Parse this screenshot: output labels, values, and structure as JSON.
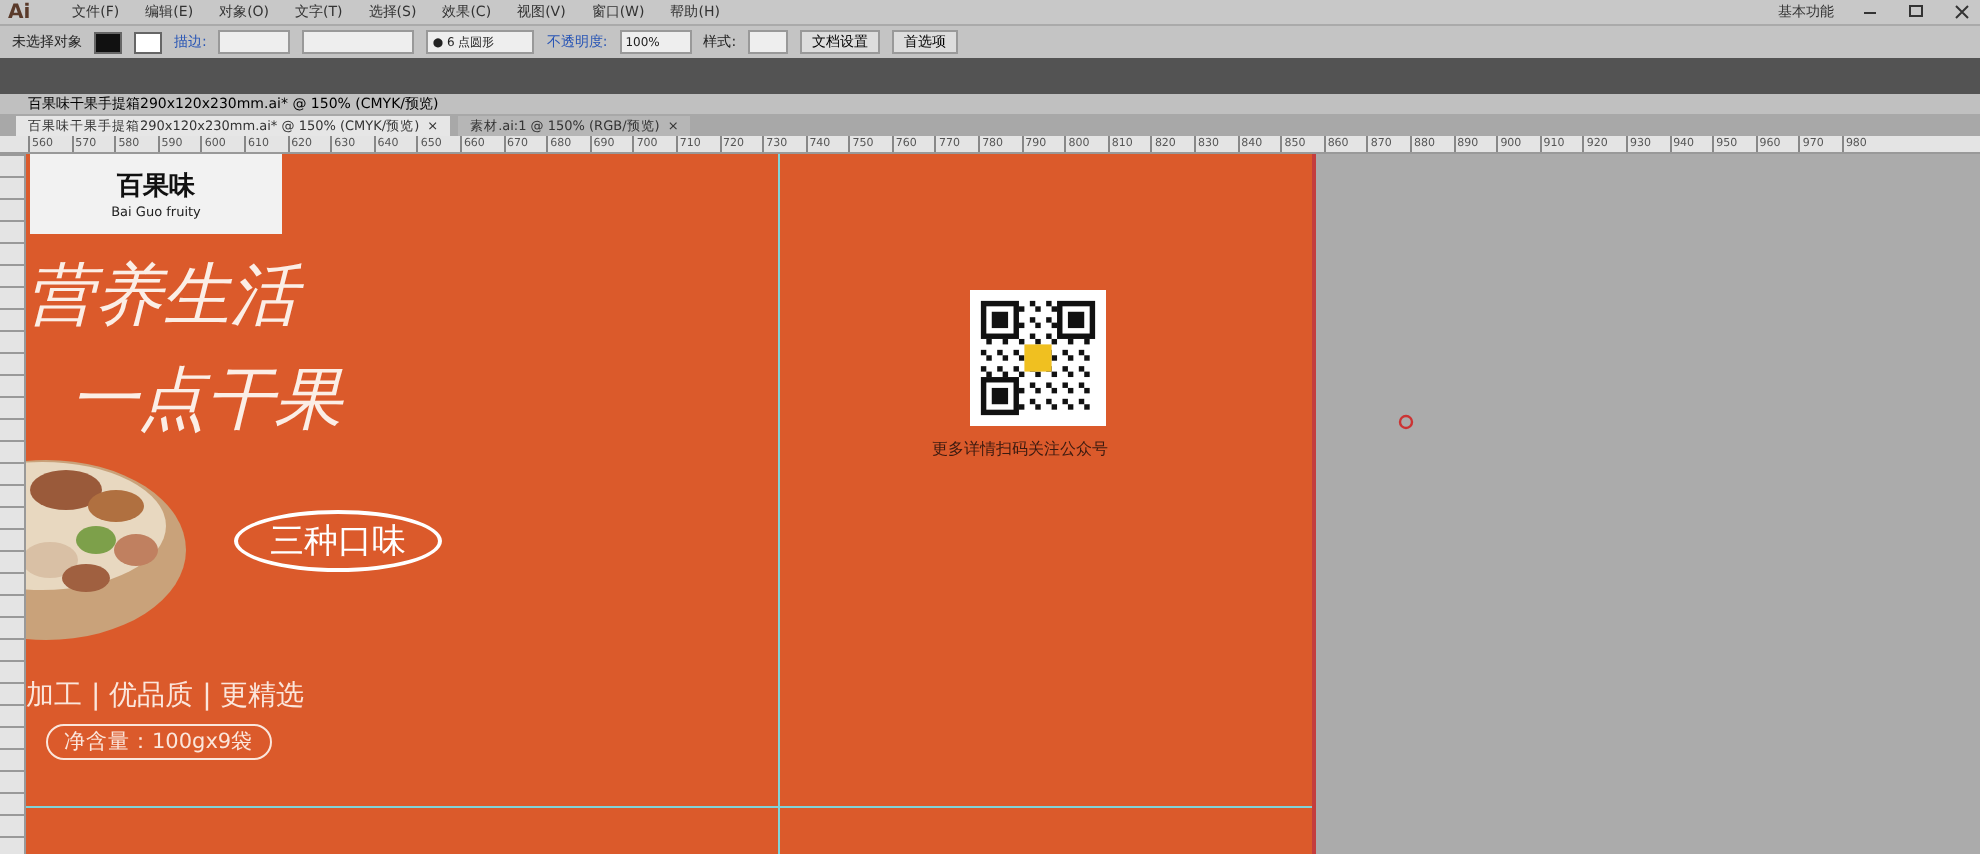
{
  "app": {
    "logo": "Ai",
    "menus": [
      "文件(F)",
      "编辑(E)",
      "对象(O)",
      "文字(T)",
      "选择(S)",
      "效果(C)",
      "视图(V)",
      "窗口(W)",
      "帮助(H)"
    ],
    "workspace": "基本功能"
  },
  "control_bar": {
    "selection": "未选择对象",
    "stroke_label": "描边:",
    "brush": "● 6 点圆形",
    "opacity_label": "不透明度:",
    "opacity": "100%",
    "style_label": "样式:",
    "buttons": [
      "文档设置",
      "首选项"
    ]
  },
  "document": {
    "title": "百果味干果手提箱290x120x230mm.ai* @ 150% (CMYK/预览)"
  },
  "tabs": [
    {
      "label": "百果味干果手提箱290x120x230mm.ai* @ 150% (CMYK/预览)",
      "close": "×",
      "selected": true
    },
    {
      "label": "素材.ai:1 @ 150% (RGB/预览)",
      "close": "×",
      "selected": false
    }
  ],
  "ruler": [
    "560",
    "570",
    "580",
    "590",
    "600",
    "610",
    "620",
    "630",
    "640",
    "650",
    "660",
    "670",
    "680",
    "690",
    "700",
    "710",
    "720",
    "730",
    "740",
    "750",
    "760",
    "770",
    "780",
    "790",
    "800",
    "810",
    "820",
    "830",
    "840",
    "850",
    "860",
    "870",
    "880",
    "890",
    "900",
    "910",
    "920",
    "930",
    "940",
    "950",
    "960",
    "970",
    "980"
  ],
  "artboard": {
    "brand": "百果味",
    "brand_en": "Bai Guo fruity",
    "headline": [
      "营养生活",
      "一点干果"
    ],
    "flavor": "三种口味",
    "features": "加工 | 优品质 | 更精选",
    "net_weight": "净含量：100gx9袋",
    "qr_caption": "更多详情扫码关注公众号"
  }
}
